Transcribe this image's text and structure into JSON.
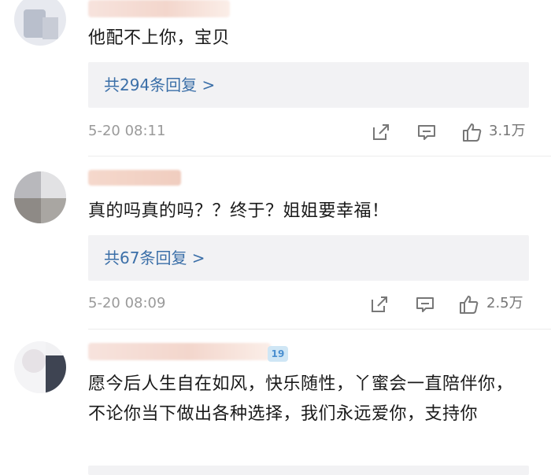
{
  "comments": [
    {
      "text": "他配不上你，宝贝",
      "replies_label": "共294条回复 >",
      "time": "5-20 08:11",
      "likes": "3.1万"
    },
    {
      "text": "真的吗真的吗？？终于？姐姐要幸福！",
      "replies_label": "共67条回复 >",
      "time": "5-20 08:09",
      "likes": "2.5万"
    },
    {
      "text": "愿今后人生自在如风，快乐随性，丫蜜会一直陪伴你，不论你当下做出各种选择，我们永远爱你，支持你"
    }
  ],
  "icons": {
    "share": "share-icon",
    "comment": "comment-icon",
    "like": "thumbs-up-icon"
  },
  "colors": {
    "reply_link": "#3b6fa8",
    "reply_bg": "#f2f2f4",
    "meta_text": "#9a9a9a"
  }
}
